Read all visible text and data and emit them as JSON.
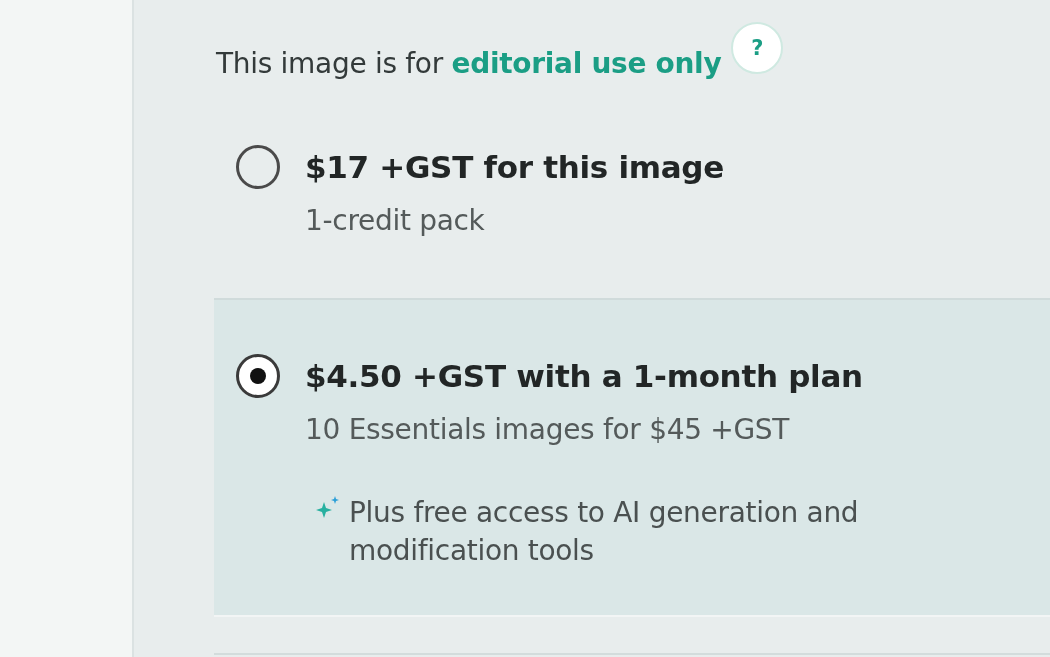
{
  "notice": {
    "text": "This image is for",
    "link": "editorial use only"
  },
  "help_button": {
    "label": "?"
  },
  "options": [
    {
      "title": "$17 +GST for this image",
      "subtitle": "1-credit pack",
      "selected": false
    },
    {
      "title": "$4.50 +GST with a 1-month plan",
      "subtitle": "10 Essentials images for $45 +GST",
      "perk": "Plus free access to AI generation and modification tools",
      "selected": true
    }
  ]
}
